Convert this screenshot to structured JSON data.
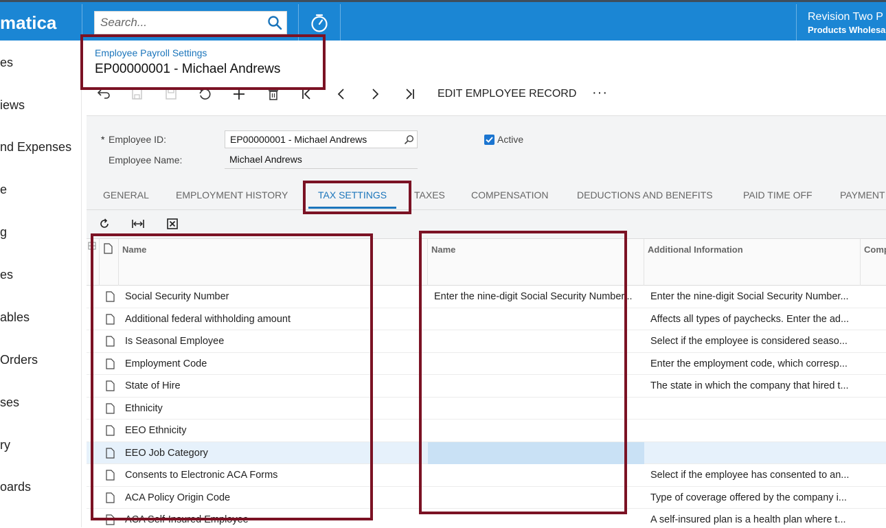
{
  "header": {
    "logo_text": "matica",
    "search_placeholder": "Search...",
    "tenant_line1": "Revision Two P",
    "tenant_line2": "Products Wholesa"
  },
  "sidebar": {
    "items": [
      "es",
      "iews",
      "nd Expenses",
      "e",
      "g",
      "es",
      "ables",
      "Orders",
      "ses",
      "ry",
      "oards"
    ]
  },
  "page": {
    "breadcrumb": "Employee Payroll Settings",
    "title": "EP00000001 - Michael Andrews"
  },
  "toolbar": {
    "edit_label": "EDIT EMPLOYEE RECORD",
    "more_label": "···"
  },
  "form": {
    "employee_id_label": "Employee ID:",
    "employee_id_value": "EP00000001 - Michael Andrews",
    "employee_name_label": "Employee Name:",
    "employee_name_value": "Michael Andrews",
    "active_label": "Active",
    "required_mark": "*"
  },
  "tabs": [
    "GENERAL",
    "EMPLOYMENT HISTORY",
    "TAX SETTINGS",
    "TAXES",
    "COMPENSATION",
    "DEDUCTIONS AND BENEFITS",
    "PAID TIME OFF",
    "PAYMENT"
  ],
  "active_tab": "TAX SETTINGS",
  "grid": {
    "columns": [
      "Name",
      "Name",
      "Additional Information",
      "Comp"
    ],
    "rows": [
      {
        "name": "Social Security Number",
        "value": "Enter the nine-digit Social Security Number...",
        "info": "Enter the nine-digit Social Security Number..."
      },
      {
        "name": "Additional federal withholding amount",
        "value": "",
        "info": "Affects all types of paychecks. Enter the ad..."
      },
      {
        "name": "Is Seasonal Employee",
        "value": "",
        "info": "Select if the employee is considered seaso..."
      },
      {
        "name": "Employment Code",
        "value": "",
        "info": "Enter the employment code, which corresp..."
      },
      {
        "name": "State of Hire",
        "value": "",
        "info": "The state in which the company that hired t..."
      },
      {
        "name": "Ethnicity",
        "value": "",
        "info": ""
      },
      {
        "name": "EEO Ethnicity",
        "value": "",
        "info": ""
      },
      {
        "name": "EEO Job Category",
        "value": "",
        "info": ""
      },
      {
        "name": "Consents to Electronic ACA Forms",
        "value": "",
        "info": "Select if the employee has consented to an..."
      },
      {
        "name": "ACA Policy Origin Code",
        "value": "",
        "info": "Type of coverage offered by the company i..."
      },
      {
        "name": "ACA Self-Insured Employee",
        "value": "",
        "info": "A self-insured plan is a health plan where t..."
      }
    ],
    "selected_row": 7
  },
  "colors": {
    "brand_blue": "#1b86d4",
    "highlight_red": "#7b1224",
    "link_blue": "#1b75bb"
  }
}
